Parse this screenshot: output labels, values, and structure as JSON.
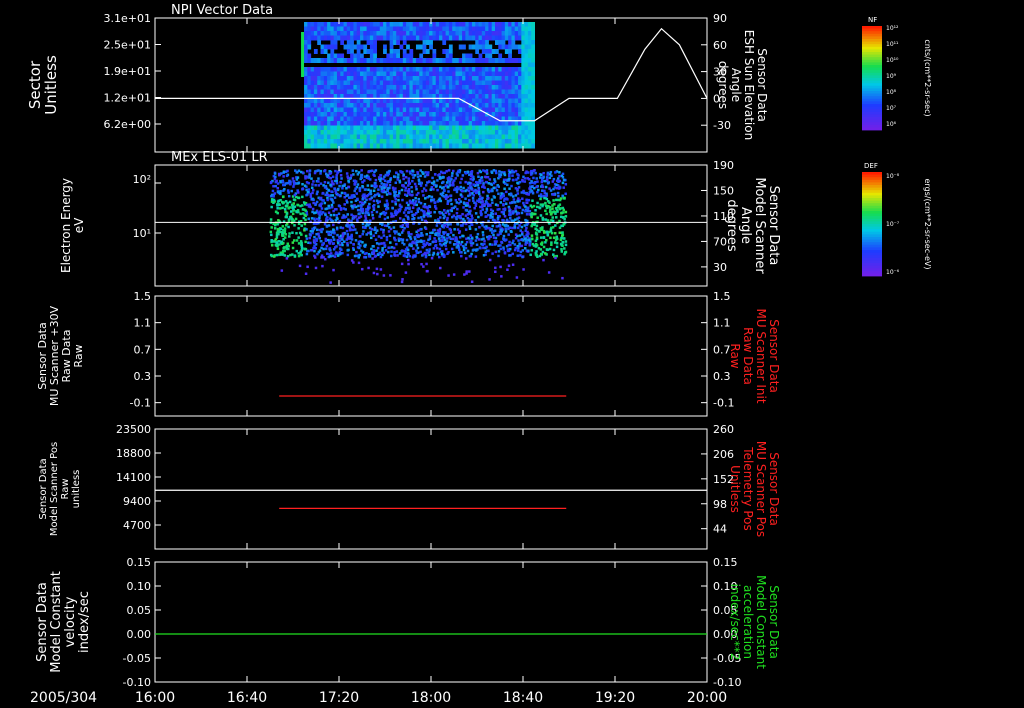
{
  "colors": {
    "background": "#000000",
    "axes": "#ffffff",
    "red_trace": "#ff2020",
    "green_trace": "#20e020",
    "white_trace": "#ffffff"
  },
  "time_axis": {
    "date_label": "2005/304",
    "ticks": [
      "16:00",
      "16:40",
      "17:20",
      "18:00",
      "18:40",
      "19:20",
      "20:00"
    ],
    "range_hours": [
      16.0,
      20.0
    ]
  },
  "chart_data": [
    {
      "type": "heatmap",
      "title": "NPI Vector Data",
      "ylabel": [
        "Sector",
        "Unitless"
      ],
      "yticks": [
        "3.1e+01",
        "2.5e+01",
        "1.9e+01",
        "1.2e+01",
        "6.2e+00"
      ],
      "y2label": [
        "Sensor Data",
        "ESH Sun Elevation",
        "Angle",
        "degrees"
      ],
      "y2ticks": [
        "90",
        "60",
        "30",
        "0",
        "-30"
      ],
      "y2lim": [
        -60,
        90
      ],
      "data_extent_hours": [
        17.08,
        18.75
      ],
      "colorbar": {
        "label": "NF",
        "unit": "cnts/(cm**2-sr-sec)",
        "ticks": [
          "10¹²",
          "10¹¹",
          "10¹⁰",
          "10⁹",
          "10⁸",
          "10⁷",
          "10⁶"
        ]
      },
      "line_series": {
        "name": "Sun Elevation",
        "points": [
          [
            16.0,
            0
          ],
          [
            18.2,
            0
          ],
          [
            18.5,
            -25
          ],
          [
            18.75,
            -25
          ],
          [
            19.0,
            0
          ],
          [
            19.35,
            0
          ],
          [
            19.55,
            55
          ],
          [
            19.67,
            78
          ],
          [
            19.8,
            60
          ],
          [
            20.0,
            0
          ]
        ]
      }
    },
    {
      "type": "heatmap",
      "title": "MEx ELS-01 LR",
      "ylabel": [
        "Electron Energy",
        "eV"
      ],
      "yticks": [
        "10²",
        "10¹"
      ],
      "y2label": [
        "Sensor Data",
        "Model Scanner",
        "Angle",
        "degrees"
      ],
      "y2ticks": [
        "190",
        "150",
        "110",
        "70",
        "30"
      ],
      "y2lim": [
        0,
        190
      ],
      "data_extent_hours": [
        16.83,
        18.97
      ],
      "colorbar": {
        "label": "DEF",
        "unit": "ergs/(cm**2-sr-sec-eV)",
        "ticks": [
          "10⁻⁶",
          "10⁻⁷",
          "10⁻⁸"
        ]
      },
      "line_series": {
        "name": "Scanner Angle",
        "points": [
          [
            16.0,
            100
          ],
          [
            20.0,
            100
          ]
        ]
      }
    },
    {
      "type": "line",
      "ylabel": [
        "Sensor Data",
        "MU Scanner +30V",
        "Raw Data",
        "Raw"
      ],
      "yticks": [
        "1.5",
        "1.1",
        "0.7",
        "0.3",
        "-0.1"
      ],
      "ylim": [
        -0.3,
        1.5
      ],
      "y2label": [
        "Sensor Data",
        "MU Scanner Init",
        "Raw Data",
        "Raw"
      ],
      "y2ticks": [
        "1.5",
        "1.1",
        "0.7",
        "0.3",
        "-0.1"
      ],
      "y2lim": [
        -0.3,
        1.5
      ],
      "series": [
        {
          "color": "#ff2020",
          "points": [
            [
              16.9,
              0.0
            ],
            [
              18.98,
              0.0
            ]
          ]
        }
      ]
    },
    {
      "type": "line",
      "ylabel": [
        "Sensor Data",
        "Model Scanner Pos",
        "Raw",
        "unitless"
      ],
      "yticks": [
        "23500",
        "18800",
        "14100",
        "9400",
        "4700"
      ],
      "ylim": [
        0,
        23500
      ],
      "y2label": [
        "Sensor Data",
        "MU Scanner Pos",
        "Telemetry Pos",
        "Unitless"
      ],
      "y2ticks": [
        "260",
        "206",
        "152",
        "98",
        "44"
      ],
      "y2lim": [
        0,
        260
      ],
      "series": [
        {
          "color": "#ffffff",
          "axis": "left",
          "points": [
            [
              16.0,
              11500
            ],
            [
              20.0,
              11500
            ]
          ]
        },
        {
          "color": "#ff2020",
          "axis": "right",
          "points": [
            [
              16.9,
              88
            ],
            [
              18.98,
              88
            ]
          ]
        }
      ]
    },
    {
      "type": "line",
      "ylabel": [
        "Sensor Data",
        "Model Constant",
        "velocity",
        "index/sec"
      ],
      "yticks": [
        "0.15",
        "0.10",
        "0.05",
        "0.00",
        "-0.05",
        "-0.10"
      ],
      "ylim": [
        -0.1,
        0.15
      ],
      "y2label": [
        "Sensor Data",
        "Model Constant",
        "acceleration",
        "index/sec**2"
      ],
      "y2ticks": [
        "0.15",
        "0.10",
        "0.05",
        "0.00",
        "-0.05",
        "-0.10"
      ],
      "y2lim": [
        -0.1,
        0.15
      ],
      "series": [
        {
          "color": "#20e020",
          "points": [
            [
              16.0,
              0.0
            ],
            [
              20.0,
              0.0
            ]
          ]
        }
      ]
    }
  ]
}
